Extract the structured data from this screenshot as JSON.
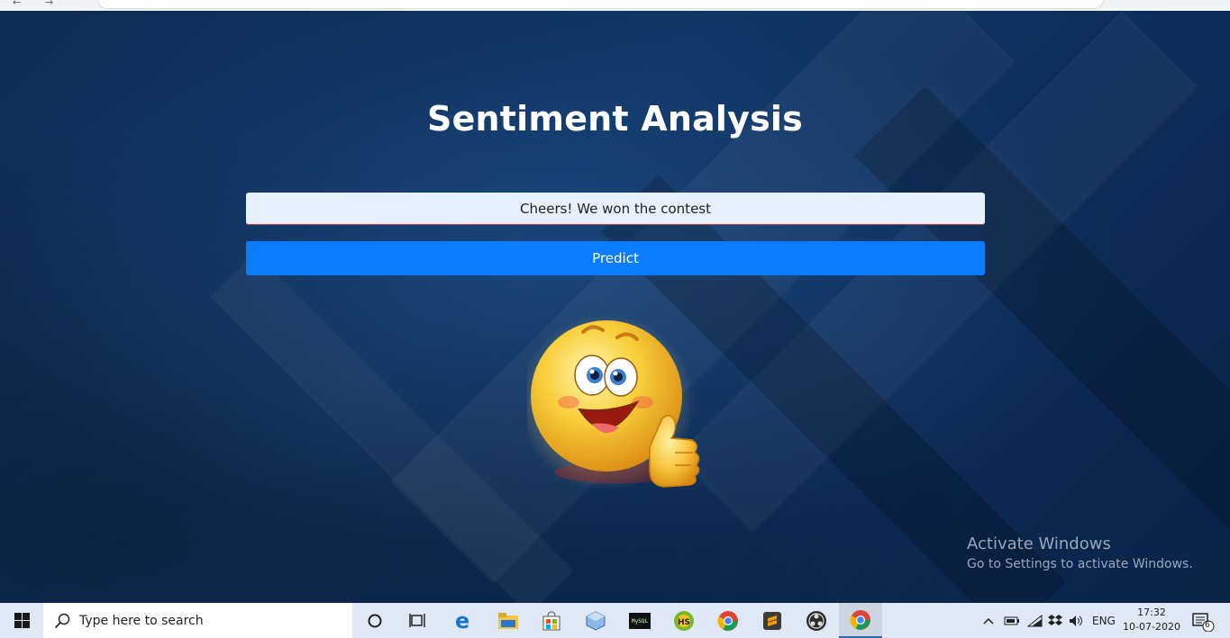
{
  "page": {
    "title": "Sentiment Analysis",
    "input_value": "Cheers! We won the contest",
    "predict_label": "Predict",
    "result_icon": "happy-thumbs-up-emoji-icon"
  },
  "watermark": {
    "line1": "Activate Windows",
    "line2": "Go to Settings to activate Windows."
  },
  "taskbar": {
    "search_placeholder": "Type here to search",
    "pinned": [
      "cortana-icon",
      "task-view-icon",
      "edge-icon",
      "file-explorer-icon",
      "store-icon",
      "cube-app-icon",
      "terminal-app-icon",
      "hs-app-icon",
      "chrome-icon",
      "sublime-text-icon",
      "obs-icon",
      "chrome-icon"
    ],
    "language": "ENG",
    "time": "17:32",
    "date": "10-07-2020",
    "notifications": "6"
  },
  "colors": {
    "accent": "#0b7bff",
    "background": "#0d2c55",
    "input_bg": "#e8f0fe"
  }
}
